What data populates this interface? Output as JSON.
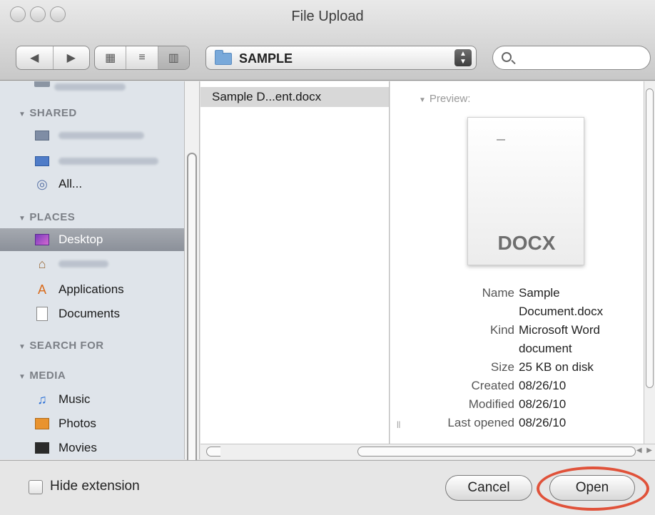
{
  "window": {
    "title": "File Upload"
  },
  "toolbar": {
    "nav_back": "◀",
    "nav_forward": "▶",
    "view_icons": "▦",
    "view_list": "≡",
    "view_columns": "▥",
    "path": "SAMPLE",
    "search_placeholder": ""
  },
  "sidebar": {
    "sections": {
      "shared": "SHARED",
      "places": "PLACES",
      "search_for": "SEARCH FOR",
      "media": "MEDIA"
    },
    "shared_items": [
      "All..."
    ],
    "places_items": [
      "Desktop",
      "Applications",
      "Documents"
    ],
    "media_items": [
      "Music",
      "Photos",
      "Movies"
    ]
  },
  "files": [
    "Sample D...ent.docx"
  ],
  "preview": {
    "label": "Preview:",
    "doc_type": "DOCX",
    "info": {
      "name_key": "Name",
      "name_val_1": "Sample",
      "name_val_2": "Document.docx",
      "kind_key": "Kind",
      "kind_val_1": "Microsoft Word",
      "kind_val_2": "document",
      "size_key": "Size",
      "size_val": "25 KB on disk",
      "created_key": "Created",
      "created_val": "08/26/10",
      "modified_key": "Modified",
      "modified_val": "08/26/10",
      "opened_key": "Last opened",
      "opened_val": "08/26/10"
    }
  },
  "footer": {
    "hide_extension": "Hide extension",
    "cancel": "Cancel",
    "open": "Open"
  },
  "colors": {
    "highlight": "#e0523a",
    "selection": "#8b9099"
  }
}
